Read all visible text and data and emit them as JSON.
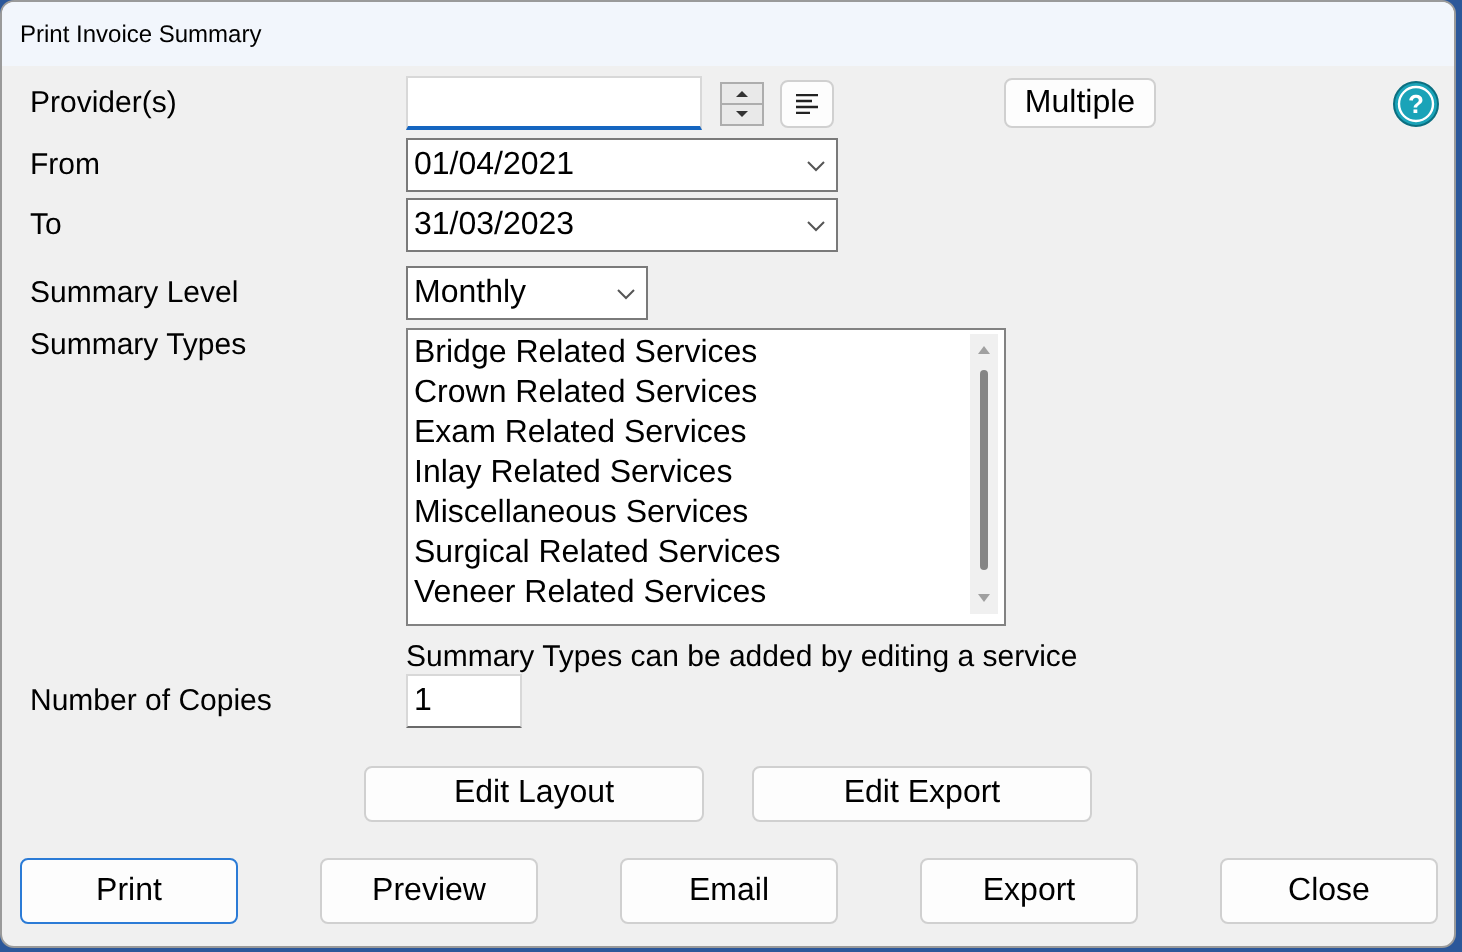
{
  "window": {
    "title": "Print Invoice Summary"
  },
  "providers": {
    "label": "Provider(s)",
    "multiple_button": "Multiple",
    "help_button": "?"
  },
  "from": {
    "label": "From",
    "value": "01/04/2021"
  },
  "to": {
    "label": "To",
    "value": "31/03/2023"
  },
  "summary_level": {
    "label": "Summary Level",
    "value": "Monthly"
  },
  "summary_types": {
    "label": "Summary Types",
    "items": [
      {
        "label": "Bridge Related Services",
        "selected": false
      },
      {
        "label": "Crown Related Services",
        "selected": false
      },
      {
        "label": "Exam Related Services",
        "selected": false
      },
      {
        "label": "Inlay Related Services",
        "selected": false
      },
      {
        "label": "Miscellaneous Services",
        "selected": false
      },
      {
        "label": "Surgical Related Services",
        "selected": false
      },
      {
        "label": "Veneer Related Services",
        "selected": false
      }
    ],
    "note": "Summary Types can be added by editing a service"
  },
  "copies": {
    "label": "Number of Copies",
    "value": "1"
  },
  "edit_buttons": [
    "Edit Layout",
    "Edit Export"
  ],
  "buttons": [
    {
      "label": "Print",
      "selected": true
    },
    {
      "label": "Preview",
      "selected": false
    },
    {
      "label": "Email",
      "selected": false
    },
    {
      "label": "Export",
      "selected": false
    },
    {
      "label": "Close",
      "selected": false
    }
  ]
}
